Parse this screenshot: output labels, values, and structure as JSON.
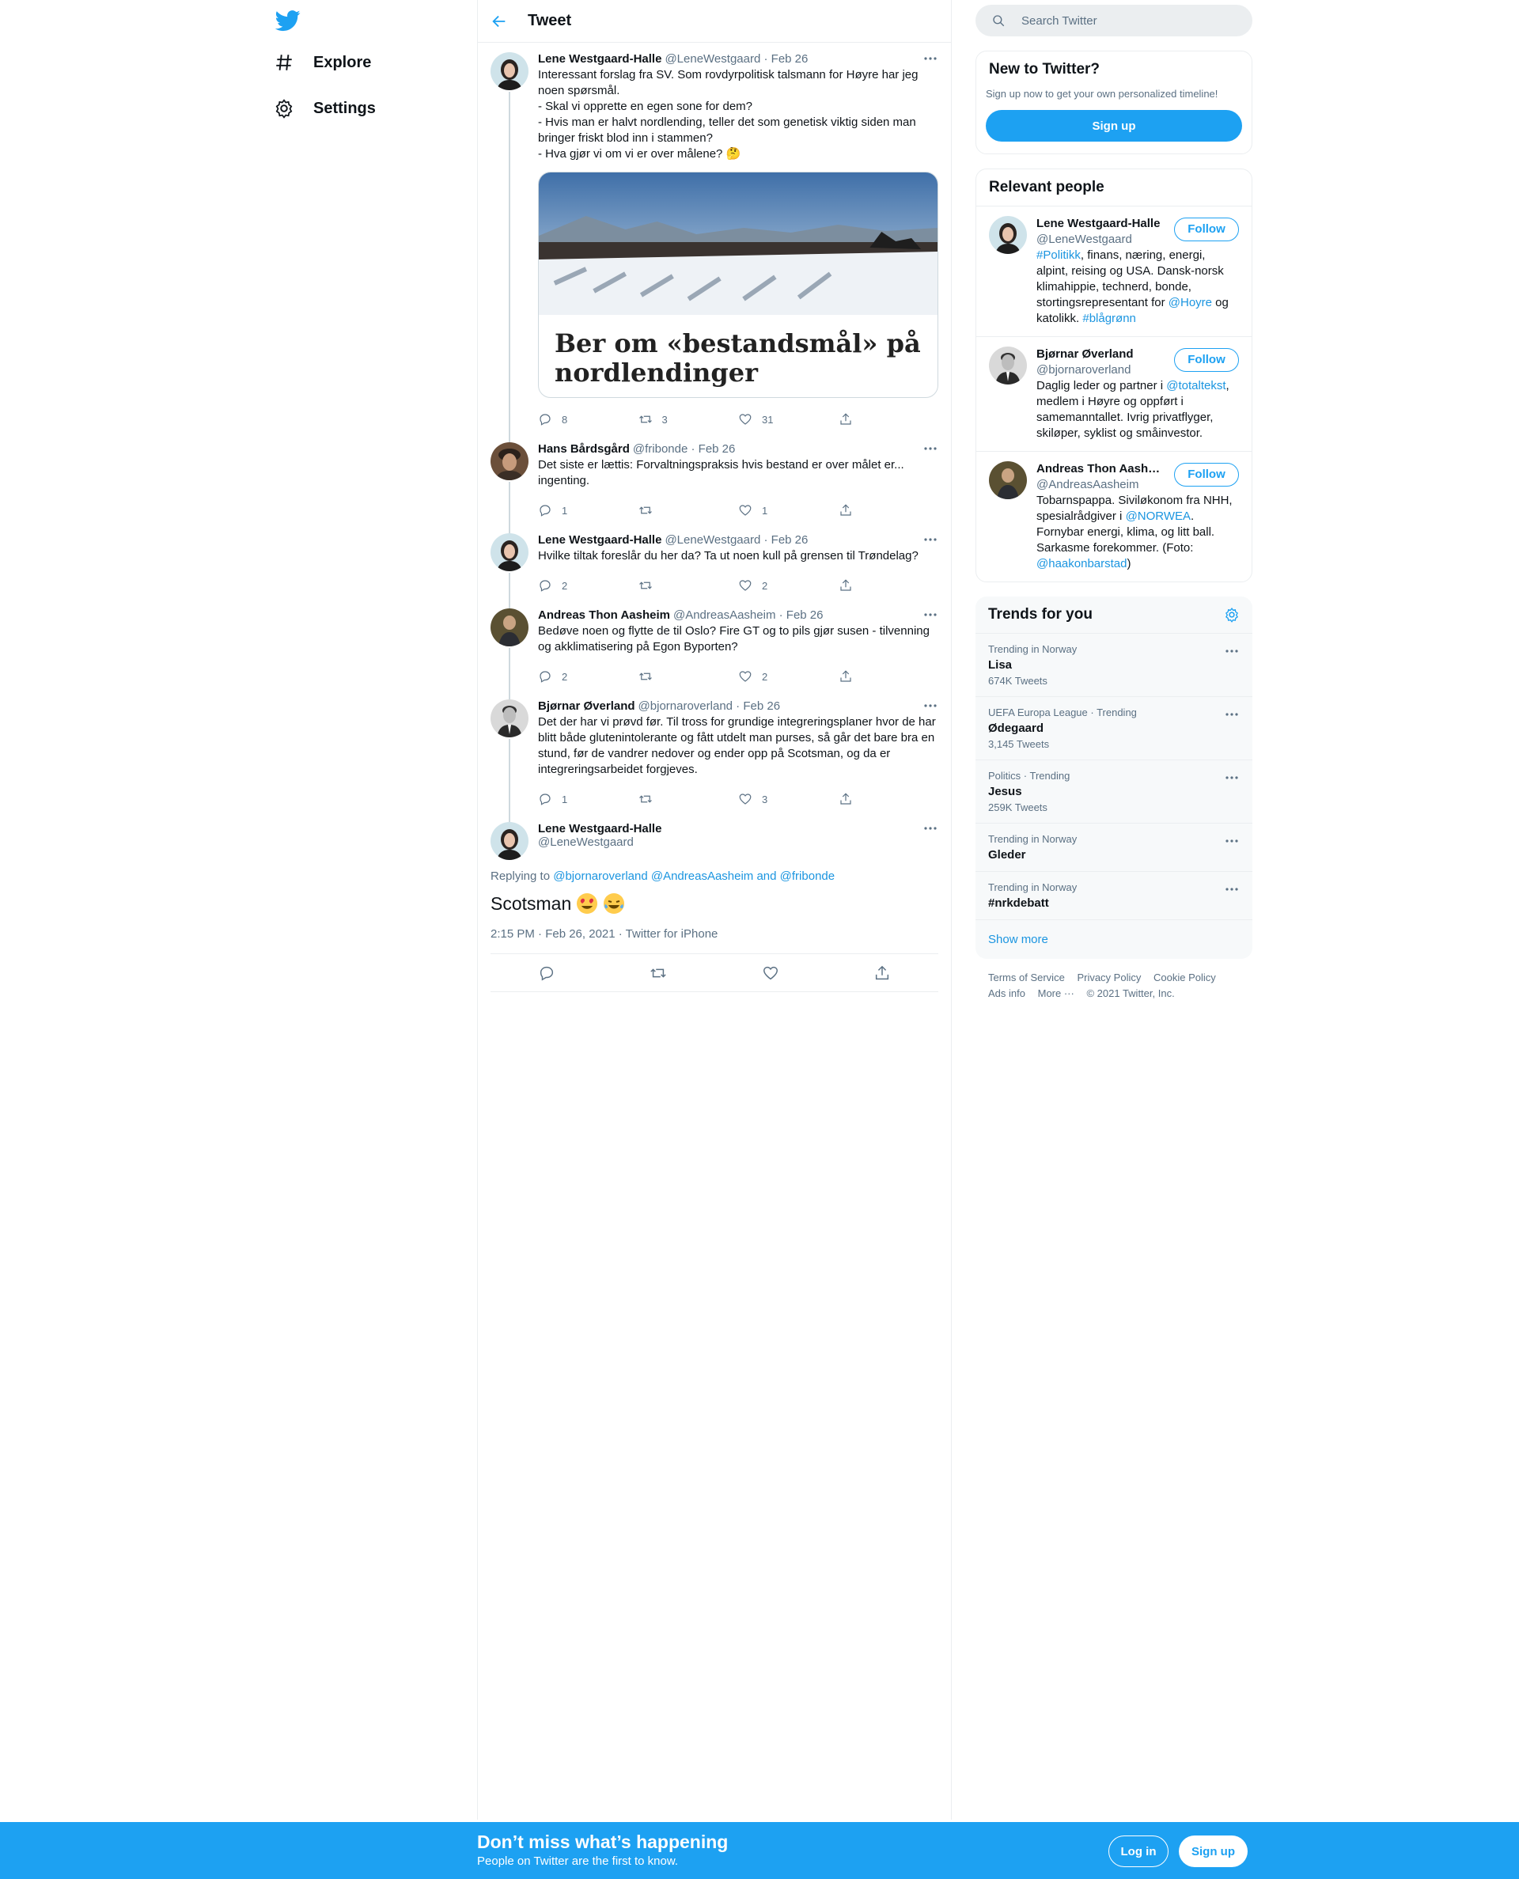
{
  "nav": {
    "items": [
      {
        "label": "Explore",
        "icon": "hashtag-icon"
      },
      {
        "label": "Settings",
        "icon": "gear-icon"
      }
    ]
  },
  "header": {
    "title": "Tweet"
  },
  "thread": [
    {
      "name": "Lene Westgaard-Halle",
      "handle": "@LeneWestgaard",
      "date": "Feb 26",
      "text": "Interessant forslag fra SV. Som rovdyrpolitisk talsmann for Høyre har jeg noen spørsmål.\n- Skal vi opprette en egen sone for dem?\n- Hvis man er halvt nordlending, teller det som genetisk viktig siden man bringer friskt blod inn i stammen?\n- Hva gjør vi om vi er over målene? 🤔",
      "card_title": "Ber om «bestandsmål» på nordlendinger",
      "replies": "8",
      "retweets": "3",
      "likes": "31"
    },
    {
      "name": "Hans Bårdsgård",
      "handle": "@fribonde",
      "date": "Feb 26",
      "text": "Det siste er lættis: Forvaltningspraksis hvis bestand er over målet er... ingenting.",
      "replies": "1",
      "retweets": "",
      "likes": "1"
    },
    {
      "name": "Lene Westgaard-Halle",
      "handle": "@LeneWestgaard",
      "date": "Feb 26",
      "text": "Hvilke tiltak foreslår du her da? Ta ut noen kull på grensen til Trøndelag?",
      "replies": "2",
      "retweets": "",
      "likes": "2"
    },
    {
      "name": "Andreas Thon Aasheim",
      "handle": "@AndreasAasheim",
      "date": "Feb 26",
      "text": "Bedøve noen og flytte de til Oslo? Fire GT og to pils gjør susen - tilvenning og akklimatisering på Egon Byporten?",
      "replies": "2",
      "retweets": "",
      "likes": "2"
    },
    {
      "name": "Bjørnar Øverland",
      "handle": "@bjornaroverland",
      "date": "Feb 26",
      "text": "Det der har vi prøvd før. Til tross for grundige integreringsplaner hvor de har blitt både glutenintolerante og fått utdelt man purses, så går det bare bra en stund, før de vandrer nedover og ender opp på Scotsman, og da er integreringsarbeidet forgjeves.",
      "replies": "1",
      "retweets": "",
      "likes": "3"
    }
  ],
  "focus": {
    "name": "Lene Westgaard-Halle",
    "handle": "@LeneWestgaard",
    "replying_prefix": "Replying to",
    "replying_to": "@bjornaroverland @AndreasAasheim and @fribonde",
    "text": "Scotsman",
    "timestamp": "2:15 PM · Feb 26, 2021 · Twitter for iPhone"
  },
  "search": {
    "placeholder": "Search Twitter"
  },
  "new_box": {
    "title": "New to Twitter?",
    "subtitle": "Sign up now to get your own personalized timeline!",
    "button": "Sign up"
  },
  "relevant": {
    "title": "Relevant people",
    "follow_label": "Follow",
    "people": [
      {
        "name": "Lene Westgaard-Halle",
        "handle": "@LeneWestgaard"
      },
      {
        "name": "Bjørnar Øverland",
        "handle": "@bjornaroverland"
      },
      {
        "name": "Andreas Thon Aash…",
        "handle": "@AndreasAasheim"
      }
    ],
    "bio1": {
      "a": "#Politikk",
      "b": ", finans, næring, energi, alpint, reising og USA. Dansk-norsk klimahippie, technerd, bonde, stortingsrepresentant for ",
      "c": "@Hoyre",
      "d": " og katolikk. ",
      "e": "#blågrønn"
    },
    "bio2": {
      "a": "Daglig leder og partner i ",
      "b": "@totaltekst",
      "c": ", medlem i Høyre og oppført i samemanntallet. Ivrig privatflyger, skiløper, syklist og småinvestor."
    },
    "bio3": {
      "a": "Tobarnspappa. Siviløkonom fra NHH, spesialrådgiver i ",
      "b": "@NORWEA",
      "c": ". Fornybar energi, klima, og litt ball. Sarkasme forekommer. (Foto: ",
      "d": "@haakonbarstad",
      "e": ")"
    }
  },
  "trends": {
    "title": "Trends for you",
    "items": [
      {
        "context": "Trending in Norway",
        "name": "Lisa",
        "count": "674K Tweets"
      },
      {
        "context": "UEFA Europa League · Trending",
        "name": "Ødegaard",
        "count": "3,145 Tweets"
      },
      {
        "context": "Politics · Trending",
        "name": "Jesus",
        "count": "259K Tweets"
      },
      {
        "context": "Trending in Norway",
        "name": "Gleder",
        "count": ""
      },
      {
        "context": "Trending in Norway",
        "name": "#nrkdebatt",
        "count": ""
      }
    ],
    "show_more": "Show more"
  },
  "footer": {
    "links": [
      "Terms of Service",
      "Privacy Policy",
      "Cookie Policy",
      "Ads info",
      "More ···",
      "© 2021 Twitter, Inc."
    ]
  },
  "bottom_bar": {
    "title": "Don’t miss what’s happening",
    "subtitle": "People on Twitter are the first to know.",
    "login": "Log in",
    "signup": "Sign up"
  },
  "colors": {
    "accent": "#1da1f2",
    "link": "#1b95e0",
    "muted": "#5b7083",
    "border": "#ebeef0"
  }
}
